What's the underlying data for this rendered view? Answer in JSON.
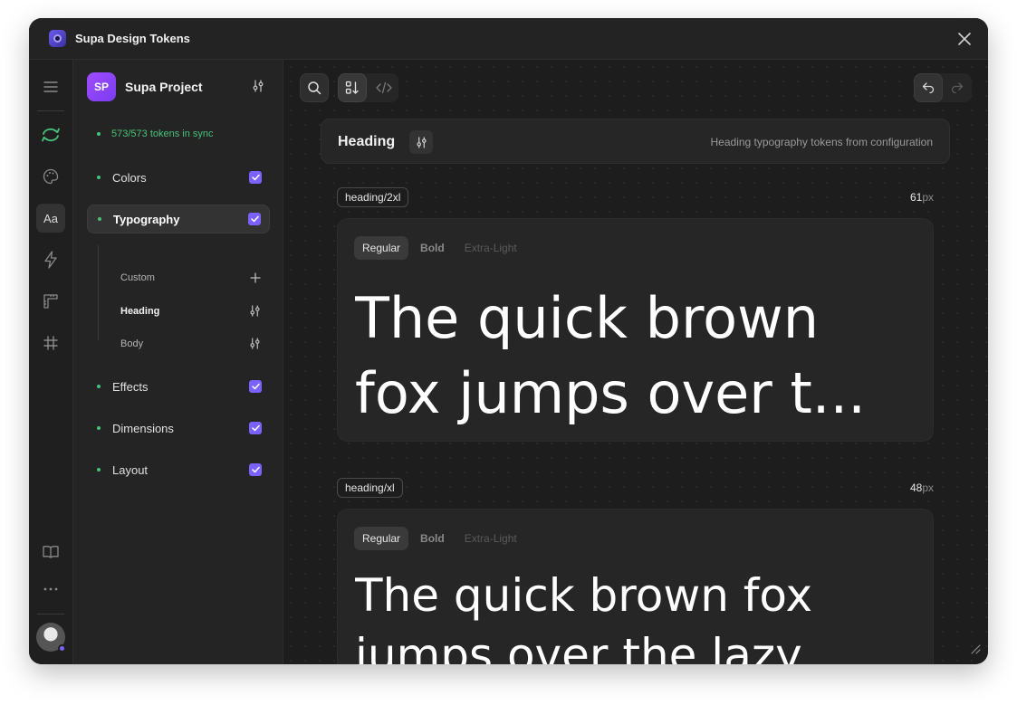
{
  "window": {
    "title": "Supa Design Tokens"
  },
  "iconbar": {
    "items": [
      "menu-icon",
      "sync-icon",
      "palette-icon",
      "typography-icon",
      "lightning-icon",
      "ruler-icon",
      "grid-hash-icon",
      "book-icon",
      "more-icon"
    ],
    "active_label": "Aa"
  },
  "sidebar": {
    "project_initials": "SP",
    "project_name": "Supa Project",
    "sync_status": "573/573 tokens in sync",
    "categories": [
      {
        "label": "Colors",
        "checked": true
      },
      {
        "label": "Typography",
        "checked": true,
        "active": true
      },
      {
        "label": "Effects",
        "checked": true
      },
      {
        "label": "Dimensions",
        "checked": true
      },
      {
        "label": "Layout",
        "checked": true
      }
    ],
    "subitems": [
      {
        "label": "Custom",
        "icon": "plus-icon"
      },
      {
        "label": "Heading",
        "icon": "sliders-icon",
        "active": true
      },
      {
        "label": "Body",
        "icon": "sliders-icon"
      }
    ]
  },
  "main": {
    "section": {
      "title": "Heading",
      "description": "Heading typography tokens from configuration"
    },
    "weights": [
      "Regular",
      "Bold",
      "Extra-Light"
    ],
    "tokens": [
      {
        "name": "heading/2xl",
        "size": "61",
        "unit": "px",
        "sample_line1": "The quick brown",
        "sample_line2": "fox jumps over t..."
      },
      {
        "name": "heading/xl",
        "size": "48",
        "unit": "px",
        "sample_line1": "The quick brown fox",
        "sample_line2": "jumps over the lazy"
      }
    ]
  },
  "colors": {
    "accent": "#7b61ff",
    "sync_green": "#47c27a",
    "project_badge": "#9b47ff"
  }
}
